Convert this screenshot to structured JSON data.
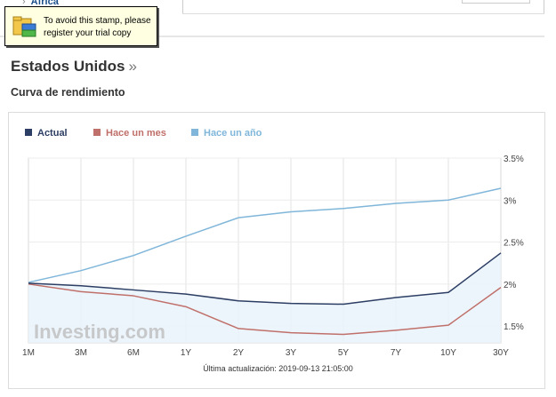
{
  "top": {
    "link_label": "África",
    "arrow": "›"
  },
  "stamp": {
    "line1": "To avoid this stamp, please",
    "line2": "register your trial copy"
  },
  "section": {
    "title": "Estados Unidos",
    "raquo": "»",
    "subtitle": "Curva de rendimiento"
  },
  "update_note": "Última actualización: 2019-09-13 21:05:00",
  "watermark": "Investing.com",
  "colors": {
    "actual": "#2c3e63",
    "mes": "#c0706a",
    "ano": "#7fb6d9",
    "fill": "#eaf3fb"
  },
  "chart_data": {
    "type": "line",
    "x": [
      "1M",
      "3M",
      "6M",
      "1Y",
      "2Y",
      "3Y",
      "5Y",
      "7Y",
      "10Y",
      "30Y"
    ],
    "y_ticks": [
      "3.5%",
      "3%",
      "2.5%",
      "2%",
      "1.5%"
    ],
    "ylim": [
      1.3,
      3.5
    ],
    "series": [
      {
        "name": "Actual",
        "values": [
          2.01,
          1.98,
          1.93,
          1.88,
          1.8,
          1.77,
          1.76,
          1.84,
          1.9,
          2.37
        ]
      },
      {
        "name": "Hace un mes",
        "values": [
          2.0,
          1.91,
          1.86,
          1.73,
          1.47,
          1.42,
          1.4,
          1.45,
          1.51,
          1.96
        ]
      },
      {
        "name": "Hace un año",
        "values": [
          2.02,
          2.16,
          2.34,
          2.57,
          2.79,
          2.86,
          2.9,
          2.96,
          3.0,
          3.14
        ]
      }
    ]
  }
}
